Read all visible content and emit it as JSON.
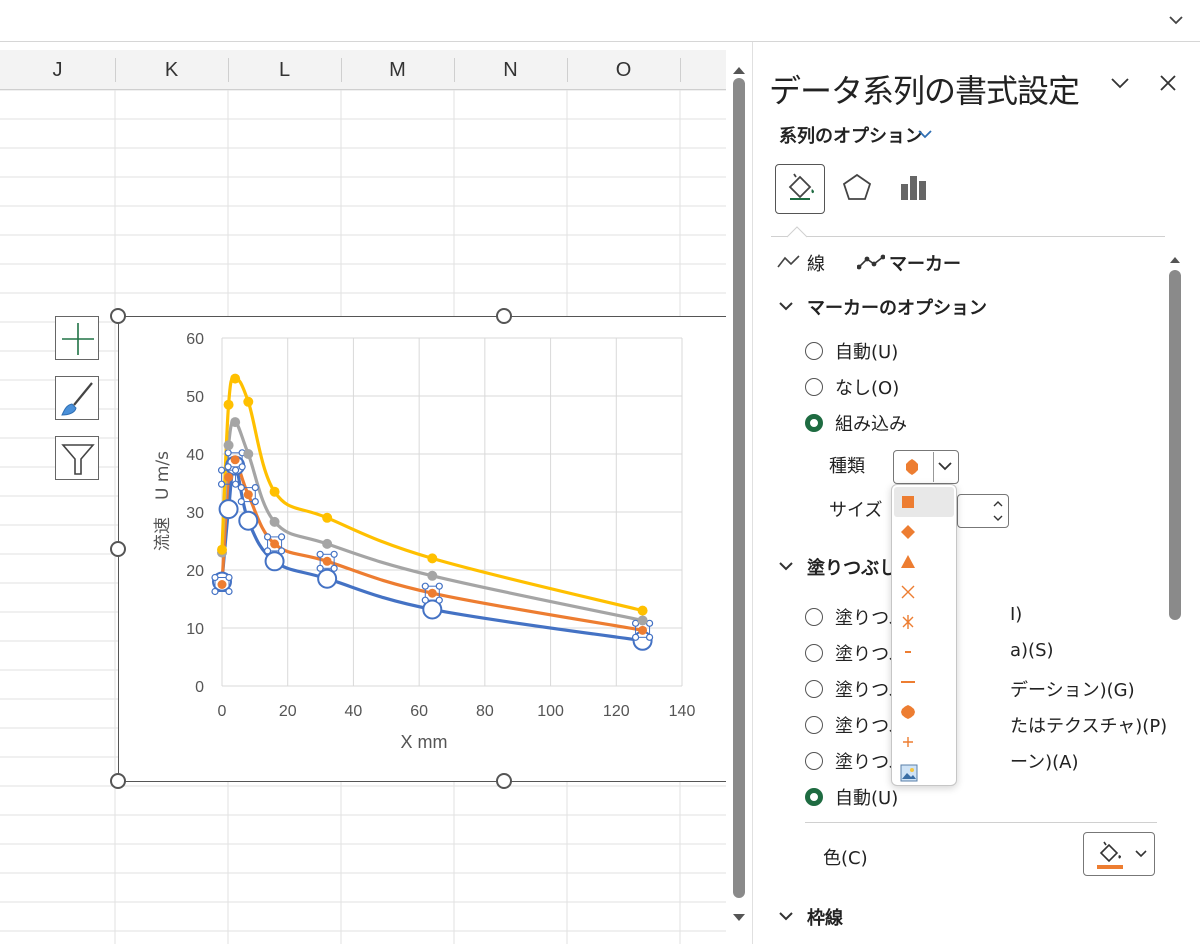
{
  "sheet": {
    "columns": [
      "J",
      "K",
      "L",
      "M",
      "N",
      "O"
    ]
  },
  "chart_data": {
    "type": "scatter",
    "xlabel": "X mm",
    "ylabel": "流速　U m/s",
    "xlim": [
      0,
      140
    ],
    "ylim": [
      0,
      60
    ],
    "x_ticks": [
      "0",
      "20",
      "40",
      "60",
      "80",
      "100",
      "120",
      "140"
    ],
    "y_ticks": [
      "0",
      "10",
      "20",
      "30",
      "40",
      "50",
      "60"
    ],
    "grid": true,
    "series": [
      {
        "color": "#4472c4",
        "x": [
          0,
          2,
          4,
          8,
          16,
          32,
          64,
          128
        ],
        "y": [
          18,
          30.5,
          38,
          28.5,
          21.5,
          18.5,
          13.2,
          7.8
        ],
        "marker": "circle-open-large"
      },
      {
        "color": "#ed7d31",
        "x": [
          0,
          2,
          4,
          8,
          16,
          32,
          64,
          128
        ],
        "y": [
          17.5,
          36,
          39,
          33,
          24.5,
          21.5,
          16,
          9.6
        ],
        "marker": "circle-selected"
      },
      {
        "color": "#a5a5a5",
        "x": [
          0,
          2,
          4,
          8,
          16,
          32,
          64,
          128
        ],
        "y": [
          23,
          41.5,
          45.5,
          40,
          28.3,
          24.5,
          19,
          11.3
        ],
        "marker": "circle"
      },
      {
        "color": "#ffc000",
        "x": [
          0,
          2,
          4,
          8,
          16,
          32,
          64,
          128
        ],
        "y": [
          23.5,
          48.5,
          53,
          49,
          33.5,
          29,
          22,
          13
        ],
        "marker": "circle"
      }
    ]
  },
  "chart_buttons": [
    "plus-icon",
    "brush-icon",
    "filter-icon"
  ],
  "pane": {
    "title": "データ系列の書式設定",
    "options_label": "系列のオプション",
    "tabs": [
      "fill-line-icon",
      "effects-icon",
      "series-options-icon"
    ],
    "sub_tabs": {
      "line": "線",
      "marker": "マーカー"
    },
    "marker_options": {
      "heading": "マーカーのオプション",
      "auto": "自動(U)",
      "none": "なし(O)",
      "builtin": "組み込み",
      "type_label": "種類",
      "size_label": "サイズ"
    },
    "fill": {
      "heading": "塗りつぶし",
      "items_left": [
        "塗りつぶ",
        "塗りつぶ",
        "塗りつぶ",
        "塗りつぶ",
        "塗りつぶ"
      ],
      "items_right": [
        "I)",
        "a)(S)",
        "デーション)(G)",
        "たはテクスチャ)(P)",
        "ーン)(A)"
      ],
      "auto": "自動(U)",
      "color_label": "色(C)"
    },
    "border": {
      "heading": "枠線"
    },
    "accent_color": "#ed7d31",
    "selected_radio_color": "#1e6b41"
  },
  "marker_dropdown": {
    "items": [
      "square",
      "diamond",
      "triangle",
      "x",
      "star",
      "short-dash",
      "long-dash",
      "circle",
      "plus",
      "picture"
    ],
    "color": "#ed7d31"
  }
}
